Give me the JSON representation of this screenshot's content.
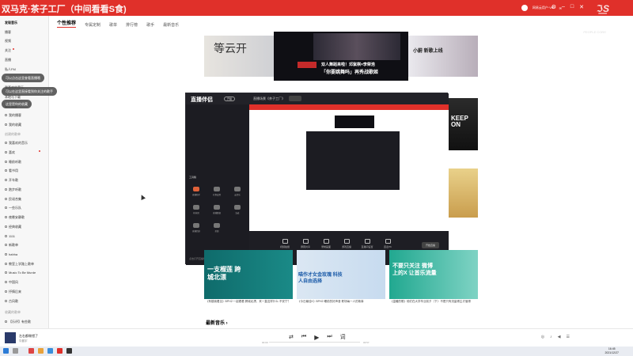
{
  "window": {
    "title": "双马克·茶子工厂（中间看看S食)",
    "subtitle": "网易云音乐",
    "user": "网易云用户·VIP"
  },
  "watermark": {
    "text": "ℑ͟S",
    "sub": "PEOPLE CORE"
  },
  "sidebar": {
    "items": [
      {
        "label": "发现音乐",
        "active": true
      },
      {
        "label": "播客"
      },
      {
        "label": "视频"
      },
      {
        "label": "关注",
        "dot": true
      },
      {
        "label": "直播"
      },
      {
        "label": "私人FM"
      },
      {
        "label": "我喜欢的音乐"
      },
      {
        "label": "本地与下载"
      },
      {
        "label": "最近播放"
      },
      {
        "label": "我的播客"
      },
      {
        "label": "我的收藏"
      },
      {
        "label": "创建的歌单"
      },
      {
        "label": "我喜欢的音乐"
      },
      {
        "label": "喜欢",
        "dot": true
      },
      {
        "label": "睡前听歌"
      },
      {
        "label": "看书用"
      },
      {
        "label": "开车歌"
      },
      {
        "label": "跑步听歌"
      },
      {
        "label": "民谣合集"
      },
      {
        "label": "一些乐队"
      },
      {
        "label": "夜晚安静歌"
      },
      {
        "label": "经典收藏"
      },
      {
        "label": "1111"
      },
      {
        "label": "新歌单"
      },
      {
        "label": "hahha"
      },
      {
        "label": "教室上学路上歌单"
      },
      {
        "label": "Music To Be Murde"
      },
      {
        "label": "中国风"
      },
      {
        "label": "抒情后来"
      },
      {
        "label": "古风歌"
      },
      {
        "label": "收藏的歌单"
      },
      {
        "label": "【乐评】有些歌"
      }
    ],
    "tooltips": [
      "可以点击这里查看直播哦",
      "可以在这里直接看到你关注的歌手",
      "这里是你的收藏"
    ]
  },
  "tabs": [
    "个性推荐",
    "专属定制",
    "歌单",
    "排行榜",
    "歌手",
    "最新音乐"
  ],
  "banner": {
    "left_text": "等云开",
    "center_text": "双人舞蹈来啦！邓紫棋×李荣浩",
    "center_sub": "「你要跳舞吗」再秀战歌姬",
    "right_text": "小蔚 新歌上线"
  },
  "embedded_app": {
    "logo": "直播伴侣",
    "badge": "开播",
    "scene": "直播场景《茶子工厂》",
    "section_label": "工具箱",
    "tools": [
      "直播助手",
      "礼物设置",
      "云音乐",
      "粉丝团",
      "直播数据",
      "连麦",
      "直播回放",
      "美颜"
    ],
    "bottom_buttons": [
      "视频拍摄",
      "屏幕共享",
      "录制画面",
      "游戏直播",
      "直播间设置",
      "连麦PK",
      "开始直播"
    ],
    "go_live": "开始直播",
    "footer_note": "点击打开直播伴侣"
  },
  "bottom_cards": [
    {
      "caption": "《有楼我看见》BPH2·一起看看 跨城北漂，来一直这样什么·不安宁？"
    },
    {
      "caption": "《今日最佳K》BPH2·睡前的好声音 职场每一人的故事"
    },
    {
      "caption": "《温暖的歌》他们在大学毕业前夕（下）· 不是只有流量博主才值得"
    }
  ],
  "card_titles": [
    "一支榴莲 跨城北漂",
    "喵作才女金玫瑰 科技人自由选择",
    "不要只关注 微博上的X 让首乐流量"
  ],
  "section_title": "最新音乐 ›",
  "player": {
    "song": "左右都做错了",
    "artist": "华晨宇",
    "elapsed": "00:00",
    "duration": "03:57"
  },
  "taskbar": {
    "time": "16:45",
    "date": "2021/12/27"
  }
}
